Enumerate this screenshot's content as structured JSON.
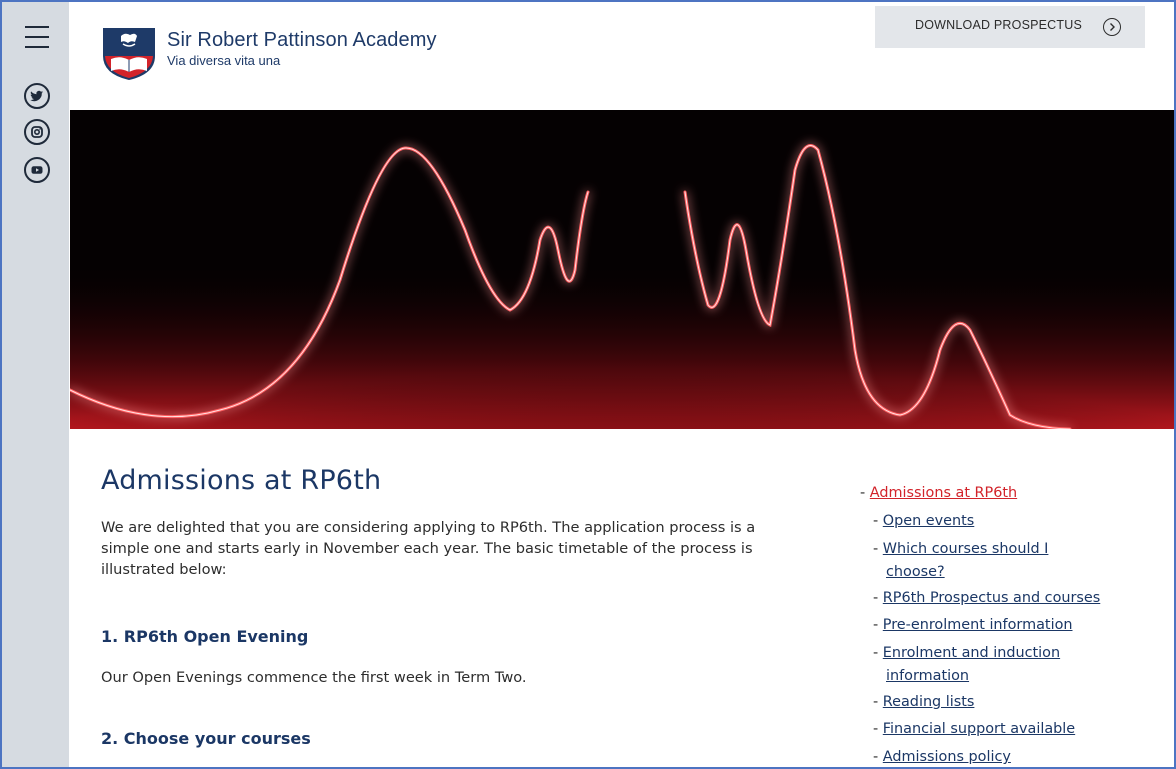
{
  "header": {
    "school_name": "Sir Robert Pattinson Academy",
    "motto": "Via diversa vita una",
    "download_label": "DOWNLOAD PROSPECTUS"
  },
  "sidebar": {
    "icons": [
      "menu-icon",
      "twitter-icon",
      "instagram-icon",
      "youtube-icon"
    ]
  },
  "main": {
    "title": "Admissions at RP6th",
    "intro": "We are delighted that you are considering applying to RP6th. The application process is a simple one and starts early in November each year. The basic timetable of the process is illustrated below:",
    "sections": [
      {
        "heading": "1. RP6th Open Evening",
        "text": "Our Open Evenings commence the first week in Term Two."
      },
      {
        "heading": "2. Choose your courses",
        "text": ""
      }
    ]
  },
  "side_nav": {
    "dash": "-",
    "items": [
      {
        "label": "Admissions at RP6th",
        "active": true
      },
      {
        "label": "Open events"
      },
      {
        "label_line1": "Which courses should I",
        "label_line2": "choose?"
      },
      {
        "label": "RP6th Prospectus and courses"
      },
      {
        "label": "Pre-enrolment information"
      },
      {
        "label_line1": "Enrolment and induction",
        "label_line2": "information"
      },
      {
        "label": "Reading lists"
      },
      {
        "label": "Financial support available"
      },
      {
        "label": "Admissions policy"
      }
    ]
  },
  "colors": {
    "brand_navy": "#1b3765",
    "accent_red": "#d2232a",
    "sidebar_bg": "#d6dbe1",
    "frame_border": "#4d74c2"
  }
}
